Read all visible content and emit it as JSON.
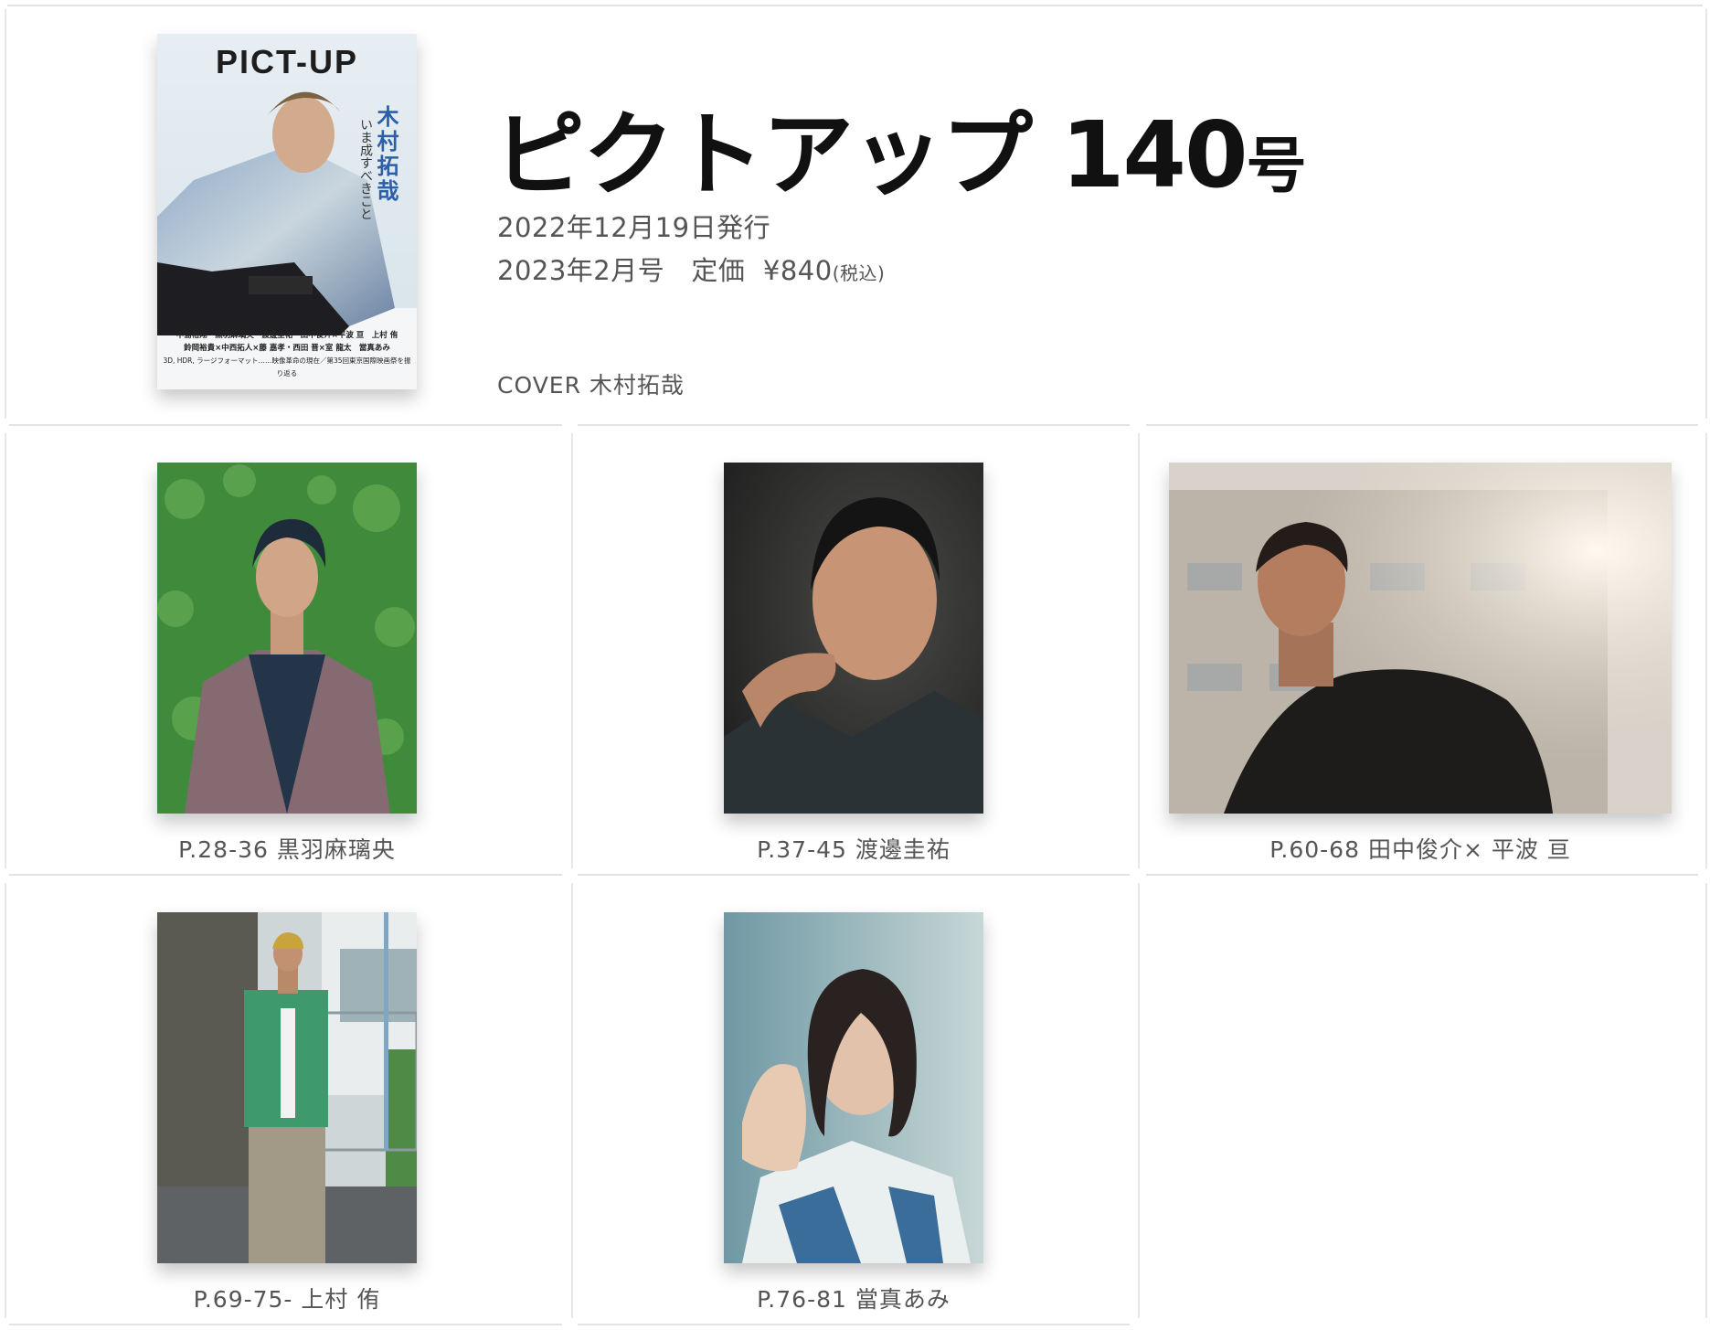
{
  "header": {
    "title_main": "ピクトアップ",
    "title_number": "140",
    "title_suffix": "号",
    "publish_date": "2022年12月19日発行",
    "issue_month": "2023年2月号",
    "price_label": "定価",
    "price_value": "¥840",
    "tax_note": "(税込)",
    "cover_label": "COVER",
    "cover_person": "木村拓哉"
  },
  "cover": {
    "logo": "PICT-UP",
    "name": "木村拓哉",
    "subtitle": "いま成すべきこと",
    "names_line1": "中島裕翔　黒羽麻璃央　渡邊圭祐　田中俊介×平波 亘　上村 侑",
    "names_line2": "鈴岡裕貴×中西拓人×藤 嘉孝・西田 晋×室 龍太　當真あみ",
    "names_line3": "3D, HDR, ラージフォーマット……映像革命の現在／第35回東京国際映画祭を振り返る"
  },
  "articles": [
    {
      "caption": "P.28-36  黒羽麻璃央"
    },
    {
      "caption": "P.37-45  渡邊圭祐"
    },
    {
      "caption": "P.60-68  田中俊介× 平波  亘"
    },
    {
      "caption": "P.69-75- 上村  侑"
    },
    {
      "caption": "P.76-81  當真あみ"
    }
  ]
}
